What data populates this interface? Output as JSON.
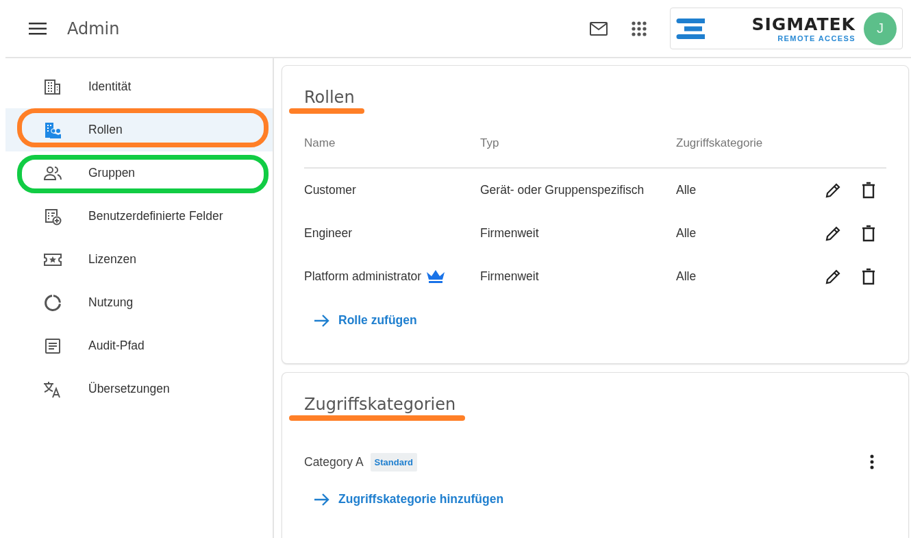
{
  "header": {
    "title": "Admin",
    "logo": {
      "name": "SIGMATEK",
      "tagline": "REMOTE ACCESS"
    },
    "avatar": {
      "initial": "J"
    }
  },
  "sidebar": {
    "items": [
      {
        "label": "Identität",
        "selected": false
      },
      {
        "label": "Rollen",
        "selected": true,
        "color": "#ff7f27"
      },
      {
        "label": "Gruppen",
        "selected": false,
        "color": "#11cc44"
      },
      {
        "label": "Benutzerdefinierte Felder",
        "selected": false
      },
      {
        "label": "Lizenzen",
        "selected": false
      },
      {
        "label": "Nutzung",
        "selected": false
      },
      {
        "label": "Audit-Pfad",
        "selected": false
      },
      {
        "label": "Übersetzungen",
        "selected": false
      }
    ]
  },
  "roles": {
    "title": "Rollen",
    "underlined": true,
    "columns": [
      "Name",
      "Typ",
      "Zugriffskategorie"
    ],
    "rows": [
      {
        "name": "Customer",
        "type": "Gerät- oder Gruppenspezifisch",
        "category": "Alle",
        "admin": false
      },
      {
        "name": "Engineer",
        "type": "Firmenweit",
        "category": "Alle",
        "admin": false
      },
      {
        "name": "Platform administrator",
        "type": "Firmenweit",
        "category": "Alle",
        "admin": true
      }
    ],
    "add_link": "Rolle zufügen"
  },
  "categories": {
    "title": "Zugriffskategorien",
    "underlined": true,
    "items": [
      {
        "name": "Category A",
        "badge": "Standard"
      }
    ],
    "add_link": "Zugriffskategorie hinzufügen"
  }
}
